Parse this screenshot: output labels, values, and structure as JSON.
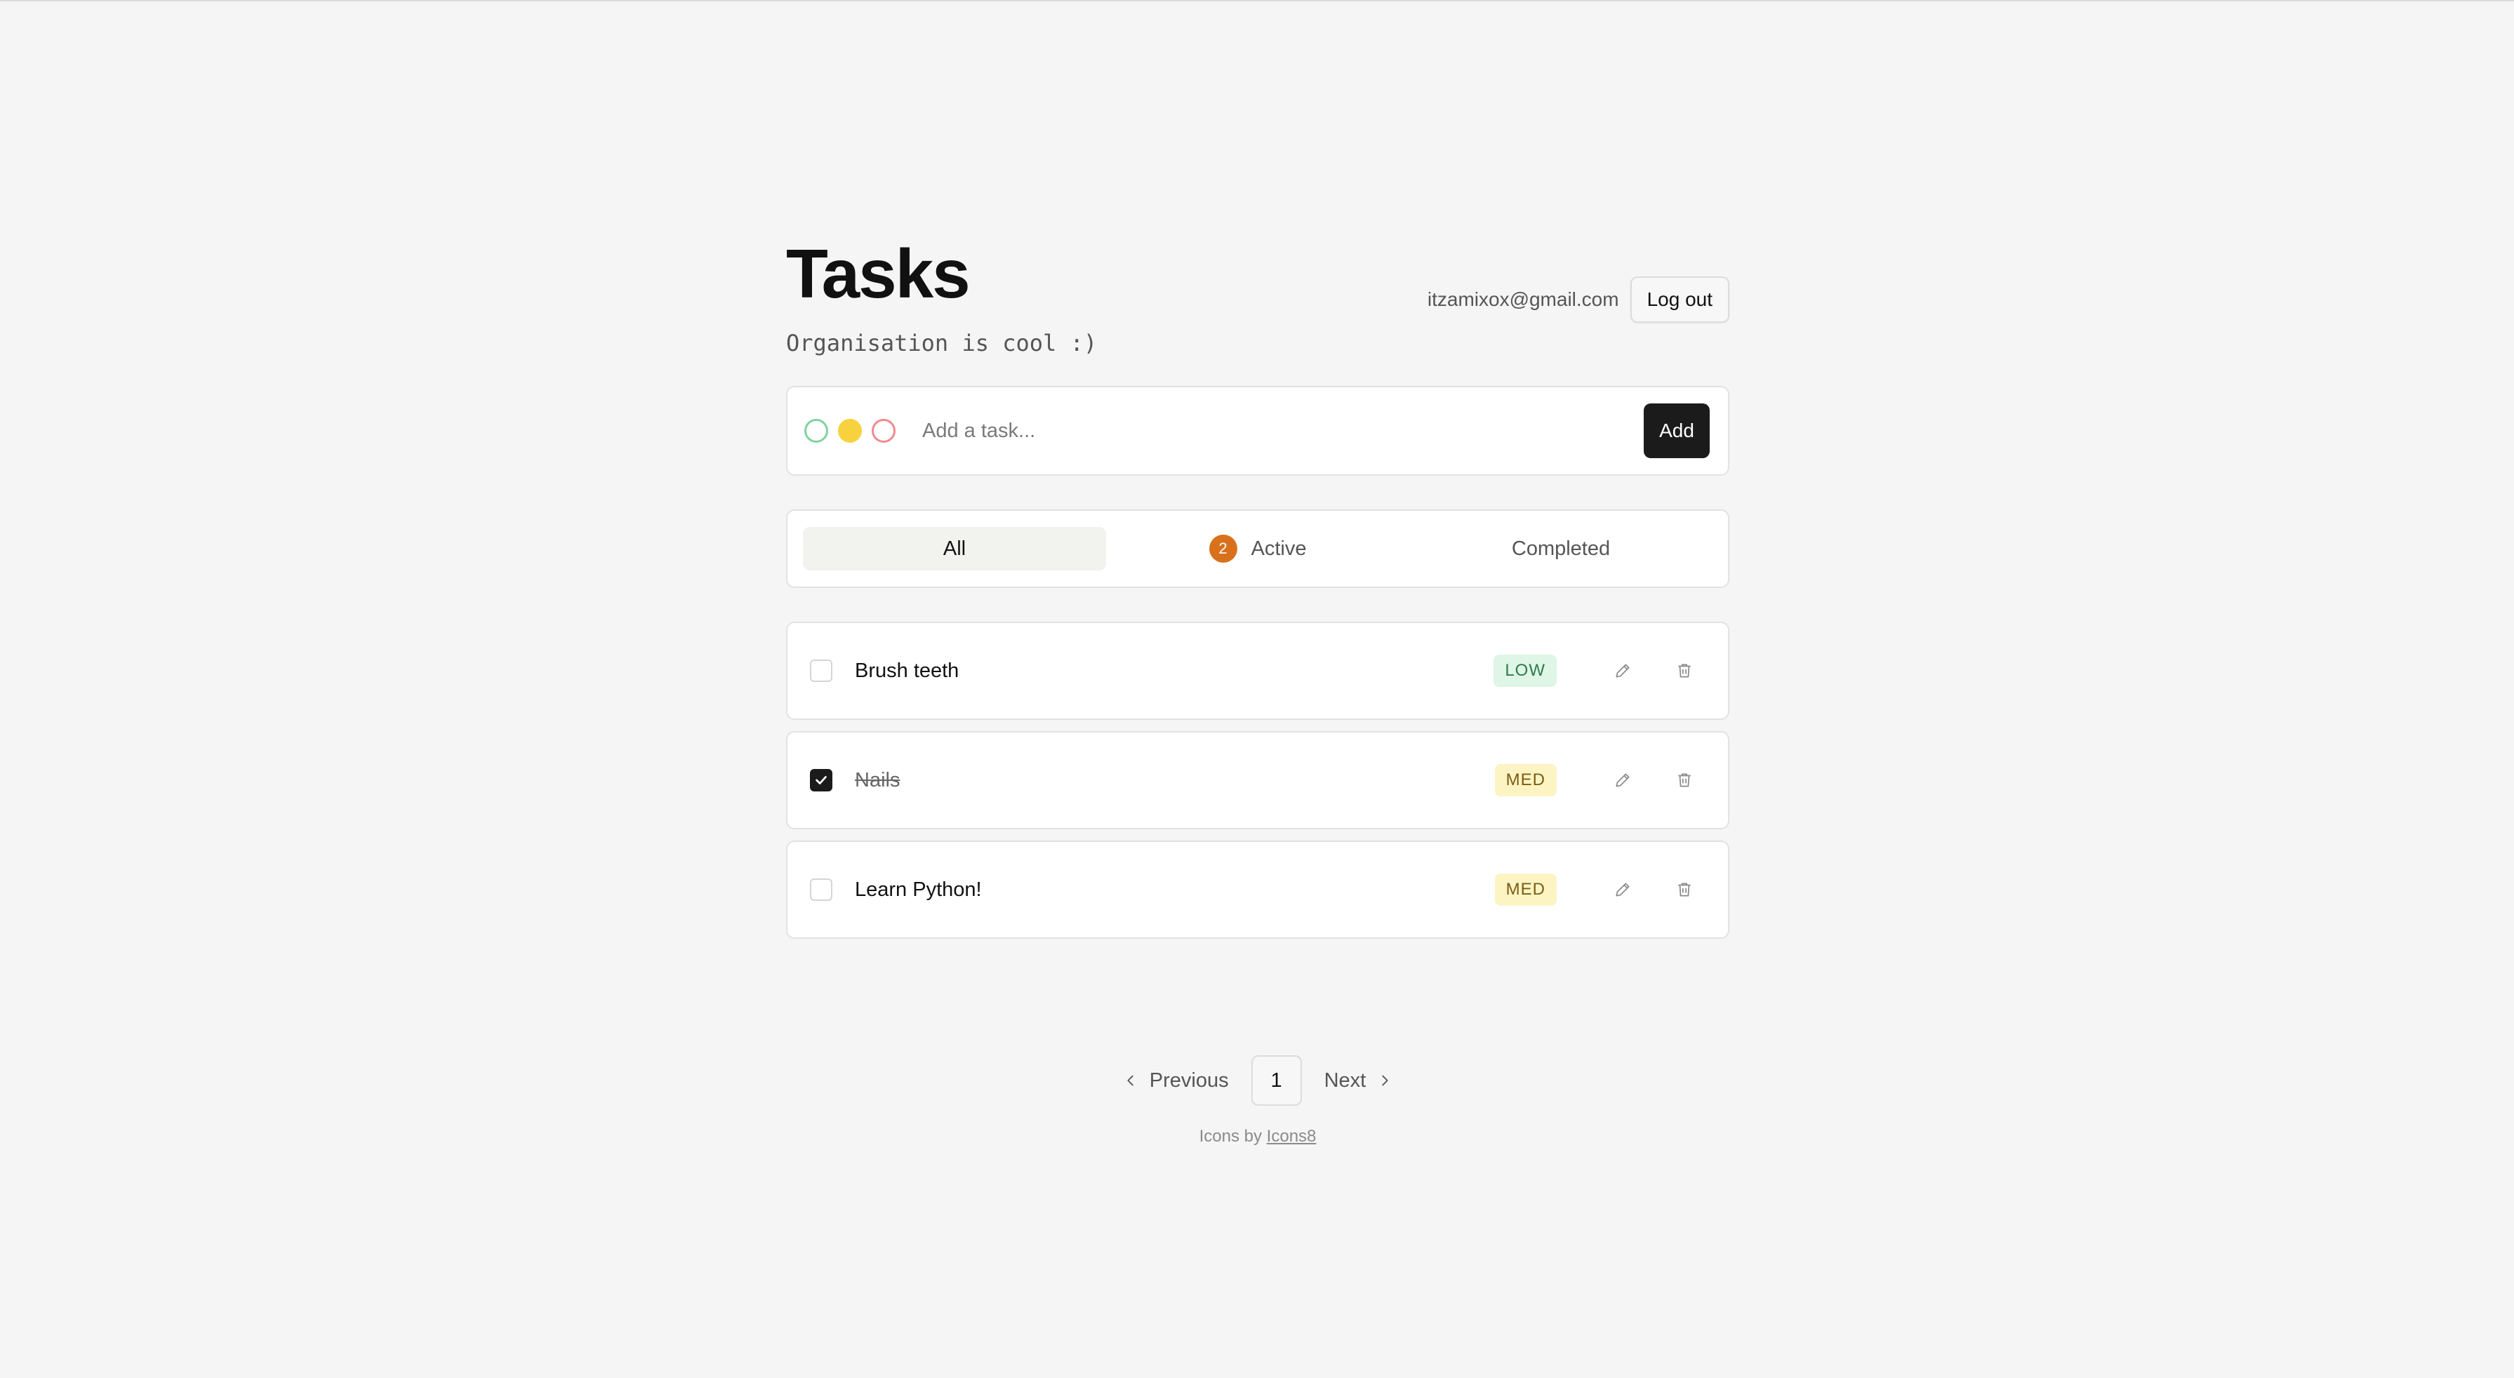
{
  "header": {
    "title": "Tasks",
    "subtitle": "Organisation is cool :)",
    "account_email": "itzamixox@gmail.com",
    "logout_label": "Log out"
  },
  "add_task": {
    "placeholder": "Add a task...",
    "add_label": "Add",
    "priority_options": [
      {
        "level": "low",
        "color": "#7fd3a0",
        "selected": false
      },
      {
        "level": "med",
        "color": "#f8d23e",
        "selected": true
      },
      {
        "level": "high",
        "color": "#f08a8f",
        "selected": false
      }
    ]
  },
  "filters": {
    "all_label": "All",
    "active_label": "Active",
    "active_count": "2",
    "completed_label": "Completed",
    "selected": "all"
  },
  "tasks": [
    {
      "title": "Brush teeth",
      "priority": "LOW",
      "completed": false
    },
    {
      "title": "Nails",
      "priority": "MED",
      "completed": true
    },
    {
      "title": "Learn Python!",
      "priority": "MED",
      "completed": false
    }
  ],
  "pagination": {
    "previous_label": "Previous",
    "current_page": "1",
    "next_label": "Next"
  },
  "footer": {
    "prefix": "Icons by",
    "link_label": "Icons8"
  },
  "colors": {
    "background": "#f5f5f5",
    "accent_dark": "#1b1b1b",
    "badge_orange": "#d9711c",
    "low_badge_bg": "#dff5e6",
    "med_badge_bg": "#fdf4c4"
  }
}
